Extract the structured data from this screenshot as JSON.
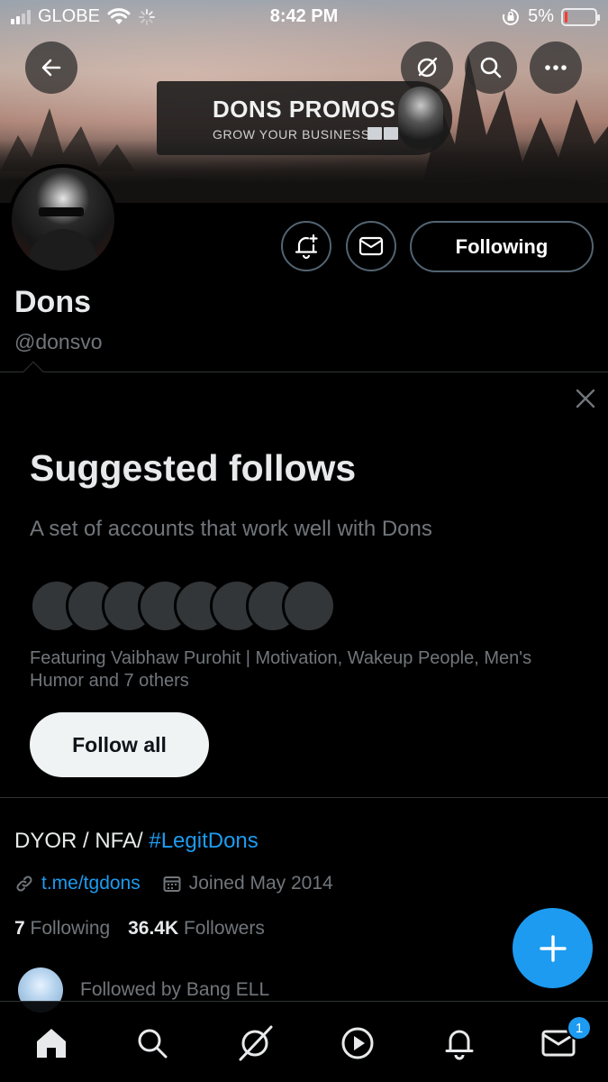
{
  "status_bar": {
    "carrier": "GLOBE",
    "time": "8:42 PM",
    "battery": "5%"
  },
  "banner": {
    "title": "DONS PROMOS",
    "subtitle": "GROW YOUR BUSINESS"
  },
  "profile": {
    "name": "Dons",
    "handle": "@donsvo",
    "following_button": "Following",
    "bio_text": "DYOR / NFA/ ",
    "bio_hashtag": "#LegitDons",
    "link": "t.me/tgdons",
    "joined": "Joined May 2014",
    "following_count": "7",
    "following_label": "Following",
    "followers_count": "36.4K",
    "followers_label": "Followers",
    "followed_by": "Followed by Bang ELL"
  },
  "suggested": {
    "title": "Suggested follows",
    "subtitle": "A set of accounts that work well with Dons",
    "featuring": "Featuring Vaibhaw Purohit | Motivation, Wakeup People, Men's Humor and 7 others",
    "follow_all": "Follow all"
  },
  "tabbar": {
    "messages_badge": "1"
  },
  "colors": {
    "accent": "#1d9bf0",
    "background": "#000000",
    "muted_text": "#71767b",
    "border": "#2f3336"
  },
  "icons": [
    "back-arrow-icon",
    "grok-icon",
    "search-icon",
    "more-icon",
    "notification-plus-icon",
    "mail-icon",
    "close-icon",
    "link-icon",
    "calendar-icon",
    "plus-icon",
    "home-icon",
    "play-icon",
    "bell-icon"
  ]
}
